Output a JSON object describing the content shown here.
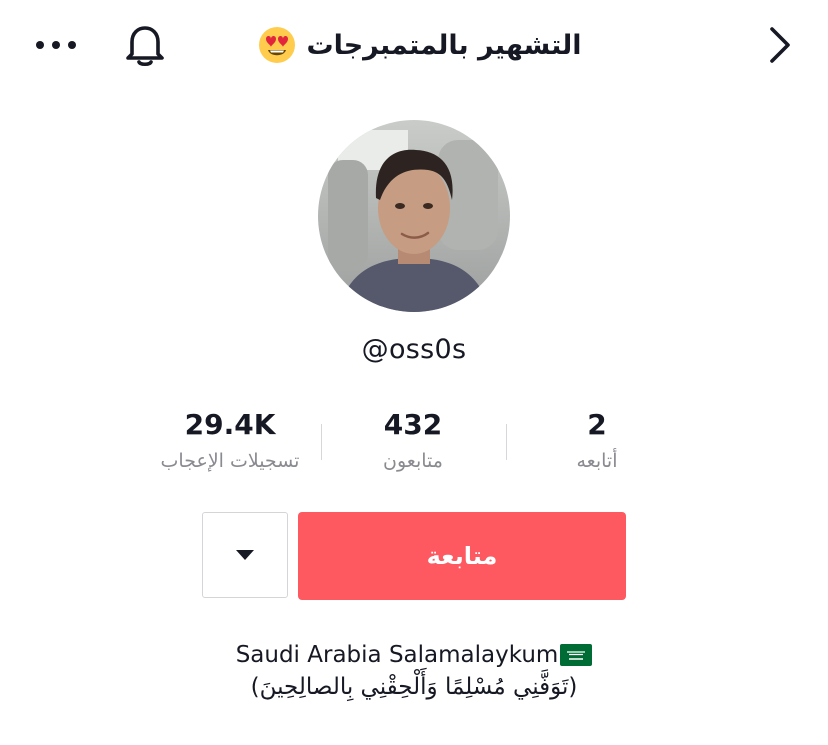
{
  "header": {
    "title": "التشهير بالمتمبرجات",
    "title_emoji": "smiling-face-with-heart-eyes",
    "icons": [
      "more-horizontal-icon",
      "bell-icon",
      "chevron-right-icon"
    ]
  },
  "profile": {
    "avatar": "profile-photo",
    "handle": "@oss0s"
  },
  "stats": {
    "likes": {
      "value": "29.4K",
      "label": "تسجيلات الإعجاب"
    },
    "followers": {
      "value": "432",
      "label": "متابعون"
    },
    "following": {
      "value": "2",
      "label": "أتابعه"
    }
  },
  "actions": {
    "follow_label": "متابعة",
    "follow_color": "#fe5860",
    "dropdown_icon": "caret-down-icon"
  },
  "bio": {
    "line1": "Saudi Arabia Salamalaykum",
    "flag": "saudi-arabia-flag",
    "line2": "(تَوَفَّنِي مُسْلِمًا وَأَلْحِقْنِي بِالصالِحِينَ)"
  }
}
